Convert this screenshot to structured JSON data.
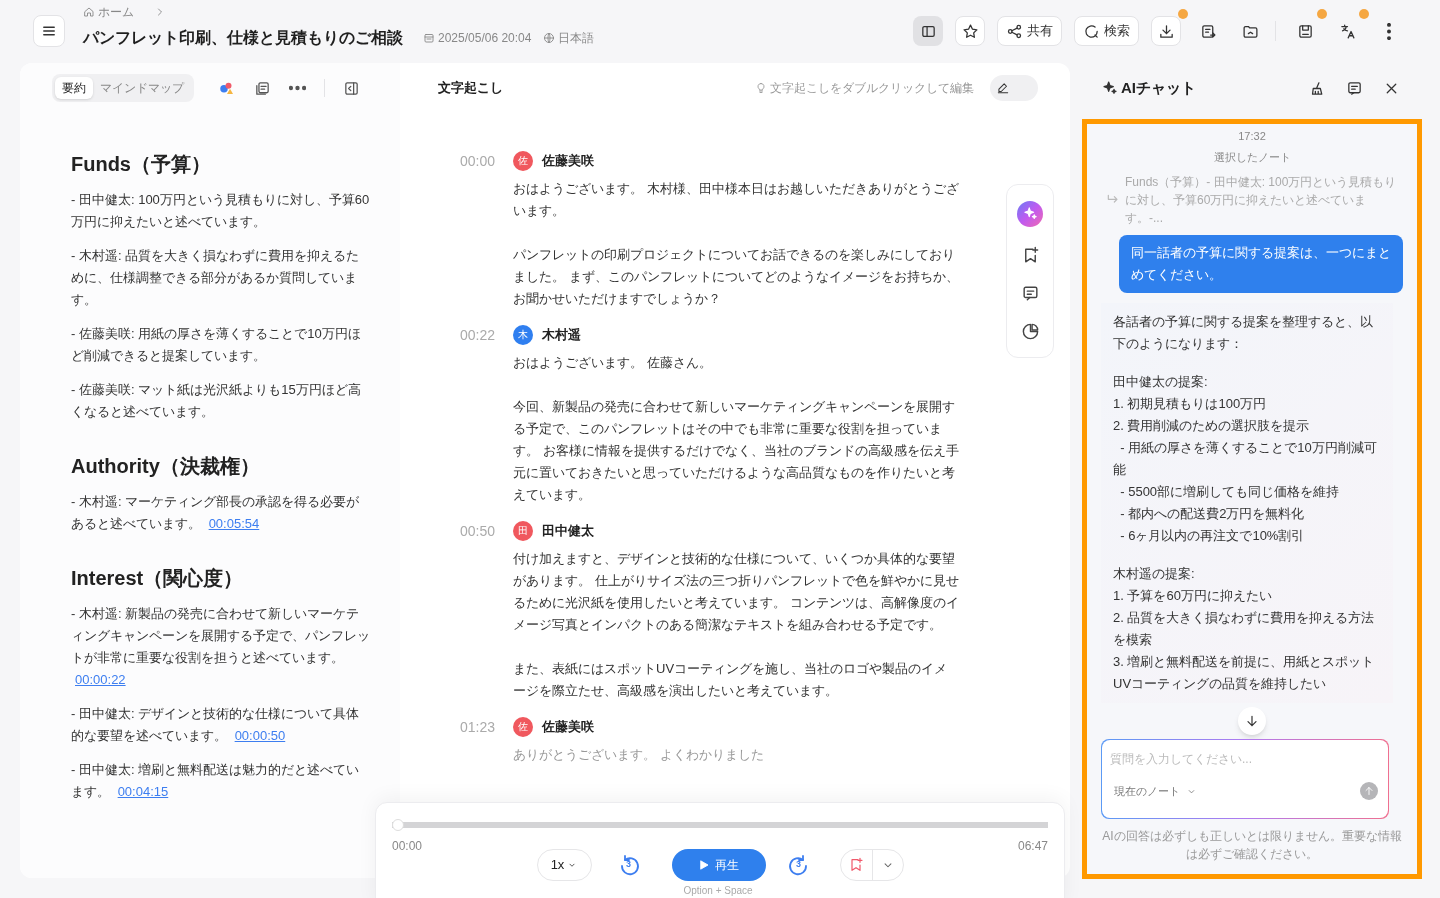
{
  "header": {
    "breadcrumb": [
      {
        "label": "ホーム"
      }
    ],
    "title": "パンフレット印刷、仕様と見積もりのご相談",
    "date": "2025/05/06 20:04",
    "language": "日本語",
    "toolbar": [
      {
        "selected": true
      },
      {
        "selected": false
      },
      {
        "label": "共有",
        "selected": false
      },
      {
        "label": "検索",
        "selected": false
      },
      {
        "selected": false,
        "badge": true
      },
      {
        "selected": false
      },
      {
        "selected": false
      },
      {
        "selected": false,
        "badge": true
      },
      {
        "selected": false,
        "badge": true
      },
      {
        "selected": false
      }
    ]
  },
  "summary": {
    "tabs": [
      {
        "label": "要約",
        "selected": true
      },
      {
        "label": "マインドマップ",
        "selected": false
      }
    ],
    "sections": [
      {
        "heading": "Funds（予算）",
        "items": [
          {
            "text": "- 田中健太: 100万円という見積もりに対し、予算60万円に抑えたいと述べています。"
          },
          {
            "text": "- 木村遥: 品質を大きく損なわずに費用を抑えるために、仕様調整できる部分があるか質問しています。"
          },
          {
            "text": "- 佐藤美咲: 用紙の厚さを薄くすることで10万円ほど削減できると提案しています。"
          },
          {
            "text": "- 佐藤美咲: マット紙は光沢紙よりも15万円ほど高くなると述べています。"
          }
        ]
      },
      {
        "heading": "Authority（決裁権）",
        "items": [
          {
            "text": "- 木村遥: マーケティング部長の承認を得る必要があると述べています。",
            "link": "00:05:54"
          }
        ]
      },
      {
        "heading": "Interest（関心度）",
        "items": [
          {
            "text": "- 木村遥: 新製品の発売に合わせて新しいマーケティングキャンペーンを展開する予定で、パンフレットが非常に重要な役割を担うと述べています。",
            "link": "00:00:22"
          },
          {
            "text": "- 田中健太: デザインと技術的な仕様について具体的な要望を述べています。",
            "link": "00:00:50"
          },
          {
            "text": "- 田中健太: 増刷と無料配送は魅力的だと述べています。",
            "link": "00:04:15"
          }
        ]
      }
    ]
  },
  "transcript": {
    "title": "文字起こし",
    "hint": "文字起こしをダブルクリックして編集",
    "edit_on": false,
    "entries": [
      {
        "time": "00:00",
        "avatar": "佐",
        "color": "#f0585e",
        "speaker": "佐藤美咲",
        "paragraphs": [
          "おはようございます。 木村様、田中様本日はお越しいただきありがとうございます。",
          "パンフレットの印刷プロジェクトについてお話できるのを楽しみにしておりました。 まず、このパンフレットについてどのようなイメージをお持ちか、お聞かせいただけますでしょうか？"
        ]
      },
      {
        "time": "00:22",
        "avatar": "木",
        "color": "#2f7ff0",
        "speaker": "木村遥",
        "paragraphs": [
          "おはようございます。 佐藤さん。",
          "今回、新製品の発売に合わせて新しいマーケティングキャンペーンを展開する予定で、このパンフレットはその中でも非常に重要な役割を担っています。 お客様に情報を提供するだけでなく、当社のブランドの高級感を伝え手元に置いておきたいと思っていただけるような高品質なものを作りたいと考えています。"
        ]
      },
      {
        "time": "00:50",
        "avatar": "田",
        "color": "#f0585e",
        "speaker": "田中健太",
        "paragraphs": [
          "付け加えますと、デザインと技術的な仕様について、いくつか具体的な要望があります。 仕上がりサイズ法の三つ折りパンフレットで色を鮮やかに見せるために光沢紙を使用したいと考えています。 コンテンツは、高解像度のイメージ写真とインパクトのある簡潔なテキストを組み合わせる予定です。",
          "また、表紙にはスポットUVコーティングを施し、当社のロゴや製品のイメージを際立たせ、高級感を演出したいと考えています。"
        ]
      },
      {
        "time": "01:23",
        "avatar": "佐",
        "color": "#f0585e",
        "speaker": "佐藤美咲",
        "paragraphs": [
          "ありがとうございます。 よくわかりました"
        ]
      }
    ]
  },
  "player": {
    "current": "00:00",
    "total": "06:47",
    "level": 0,
    "speed": "1x",
    "skip_back": "3",
    "play": "再生",
    "skip_forward": "3",
    "shortcut": "Option + Space"
  },
  "chat": {
    "title": "AIチャット",
    "time": "17:32",
    "selected_note_label": "選択したノート",
    "quoted_note": "Funds（予算）- 田中健太: 100万円という見積もりに対し、予算60万円に抑えたいと述べています。-...",
    "user_message": "同一話者の予算に関する提案は、一つにまとめてください。",
    "response": [
      [
        "各話者の予算に関する提案を整理すると、以下のようになります："
      ],
      [
        "田中健太の提案:",
        "1. 初期見積もりは100万円",
        "2. 費用削減のための選択肢を提示",
        "  - 用紙の厚さを薄くすることで10万円削減可能",
        "  - 5500部に増刷しても同じ価格を維持",
        "  - 都内への配送費2万円を無料化",
        "  - 6ヶ月以内の再注文で10%割引"
      ],
      [
        "木村遥の提案:",
        "1. 予算を60万円に抑えたい",
        "2. 品質を大きく損なわずに費用を抑える方法を模索",
        "3. 増刷と無料配送を前提に、用紙とスポットUVコーティングの品質を維持したい"
      ]
    ],
    "input_placeholder": "質問を入力してください...",
    "scope": "現在のノート",
    "disclaimer": "AIの回答は必ずしも正しいとは限りません。重要な情報は必ずご確認ください。"
  }
}
